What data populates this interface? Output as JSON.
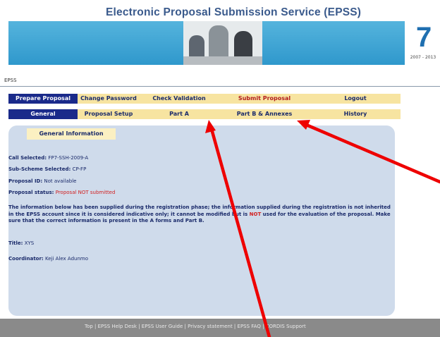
{
  "header": {
    "title": "Electronic Proposal Submission Service  (EPSS)",
    "logo_years": "2007 - 2013"
  },
  "brand_small": "EPSS",
  "nav_primary": [
    {
      "label": "Prepare Proposal",
      "active": true
    },
    {
      "label": "Change Password",
      "active": false
    },
    {
      "label": "Check Validation",
      "active": false
    },
    {
      "label": "Submit Proposal",
      "active": false,
      "color": "#b31d1d"
    },
    {
      "label": "Logout",
      "active": false
    }
  ],
  "nav_secondary": [
    {
      "label": "General",
      "active": true
    },
    {
      "label": "Proposal Setup",
      "active": false
    },
    {
      "label": "Part A",
      "active": false
    },
    {
      "label": "Part B & Annexes",
      "active": false
    },
    {
      "label": "History",
      "active": false
    }
  ],
  "panel": {
    "subtab": "General Information",
    "call_label": "Call Selected:",
    "call_value": "FP7-SSH-2009-A",
    "subscheme_label": "Sub-Scheme Selected:",
    "subscheme_value": "CP-FP",
    "proposal_id_label": "Proposal ID:",
    "proposal_id_value": "Not available",
    "status_label": "Proposal status:",
    "status_value": "Proposal NOT submitted",
    "notice_part1": "The information below has been supplied during the registration phase; the information supplied during the registration is not inherited in the EPSS account since it is considered indicative only; it cannot be modified but is ",
    "notice_not": "NOT",
    "notice_part2": " used for the evaluation of the proposal. Make sure that the correct information is present in the A forms and Part B.",
    "title_label": "Title:",
    "title_value": "XYS",
    "coordinator_label": "Coordinator:",
    "coordinator_value": "Keji Alex Adunmo"
  },
  "footer": {
    "links": [
      "Top",
      "EPSS Help Desk",
      "EPSS User Guide",
      "Privacy statement",
      "EPSS FAQ",
      "CORDIS Support"
    ],
    "separator": " | "
  },
  "colors": {
    "tab_bg": "#f7e4a1",
    "tab_active_bg": "#1a2a8a",
    "panel_bg": "#cfdbeb",
    "banner_blue": "#3aa3d5",
    "annotation_red": "#ee0000"
  }
}
